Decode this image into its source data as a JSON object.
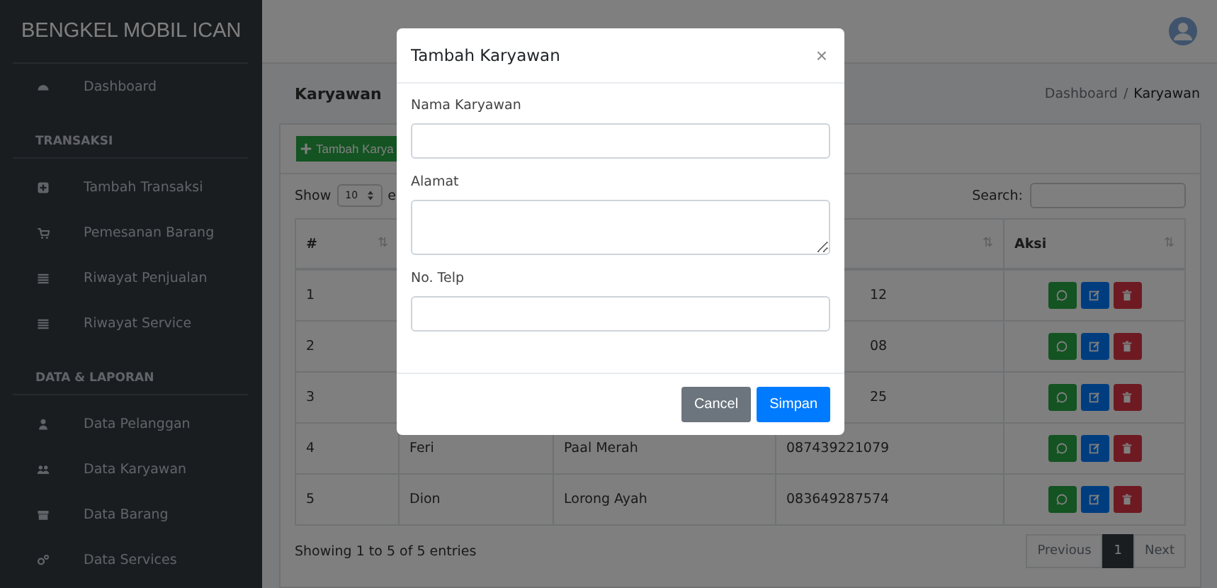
{
  "sidebar": {
    "brand": "BENGKEL MOBIL ICAN",
    "sections": [
      {
        "items": [
          {
            "kind": "dashboard",
            "label": "Dashboard"
          }
        ]
      },
      {
        "title": "TRANSAKSI",
        "items": [
          {
            "kind": "plus",
            "label": "Tambah Transaksi"
          },
          {
            "kind": "cart",
            "label": "Pemesanan Barang"
          },
          {
            "kind": "list",
            "label": "Riwayat Penjualan"
          },
          {
            "kind": "list",
            "label": "Riwayat Service"
          }
        ]
      },
      {
        "title": "DATA & LAPORAN",
        "items": [
          {
            "kind": "user",
            "label": "Data Pelanggan"
          },
          {
            "kind": "users",
            "label": "Data Karyawan"
          },
          {
            "kind": "archive",
            "label": "Data Barang"
          },
          {
            "kind": "cogs",
            "label": "Data Services"
          }
        ]
      }
    ]
  },
  "content_header": {
    "title": "Karyawan",
    "breadcrumb_separator": "/",
    "breadcrumb": [
      {
        "label": "Dashboard",
        "selected": false
      },
      {
        "label": "Karyawan",
        "selected": true
      }
    ]
  },
  "card": {
    "add_button": "Tambah Karya",
    "length_label": "Show",
    "length_value": "10",
    "length_suffix": "e",
    "search_label": "Search:",
    "table": {
      "columns": [
        {
          "label": "#",
          "sort": "⇅"
        },
        {},
        {},
        {
          "sort": "⇅"
        },
        {
          "label": "Aksi",
          "sort": "⇅"
        }
      ],
      "rows": [
        {
          "no": "1",
          "phone": "12"
        },
        {
          "no": "2",
          "phone": "08"
        },
        {
          "no": "3",
          "phone": "25"
        },
        {
          "no": "4",
          "name": "Feri",
          "address": "Paal Merah",
          "phone": "087439221079"
        },
        {
          "no": "5",
          "name": "Dion",
          "address": "Lorong Ayah",
          "phone": "083649287574"
        }
      ]
    },
    "info": "Showing 1 to 5 of 5 entries",
    "pages": [
      {
        "label": "Previous",
        "selected": false,
        "disabled": true
      },
      {
        "label": "1",
        "selected": true,
        "disabled": false
      },
      {
        "label": "Next",
        "selected": false,
        "disabled": true
      }
    ]
  },
  "modal": {
    "title": "Tambah Karyawan",
    "close": "×",
    "fields": [
      {
        "label": "Nama Karyawan",
        "kind": "input"
      },
      {
        "label": "Alamat",
        "kind": "textarea"
      },
      {
        "label": "No. Telp",
        "kind": "input"
      }
    ],
    "buttons": [
      {
        "label": "Cancel",
        "kind": "secondary"
      },
      {
        "label": "Simpan",
        "kind": "primary"
      }
    ]
  }
}
